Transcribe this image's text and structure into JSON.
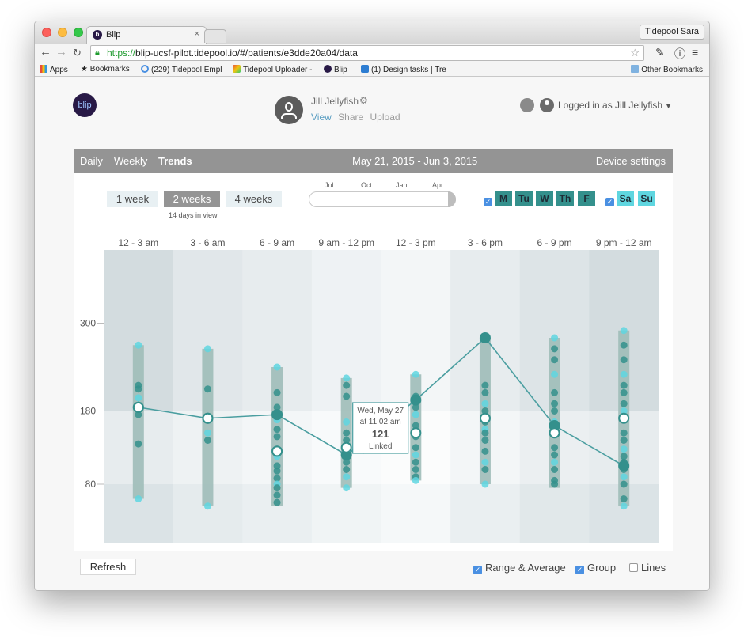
{
  "browser": {
    "tab_title": "Blip",
    "tab_close": "×",
    "profile": "Tidepool Sara",
    "url_protocol": "https://",
    "url_rest": "blip-ucsf-pilot.tidepool.io/#/patients/e3dde20a04/data",
    "bookmarks": [
      {
        "label": "Apps",
        "icon": "apps-grid-icon"
      },
      {
        "label": "Bookmarks",
        "icon": "star-icon"
      },
      {
        "label": "(229) Tidepool Empl",
        "icon": "tidepool-icon"
      },
      {
        "label": "Tidepool Uploader -",
        "icon": "uploader-icon"
      },
      {
        "label": "Blip",
        "icon": "blip-icon"
      },
      {
        "label": "(1) Design tasks | Tre",
        "icon": "trello-icon"
      }
    ],
    "other_bookmarks": "Other Bookmarks"
  },
  "header": {
    "logo_text": "blip",
    "patient_name": "Jill Jellyfish",
    "links": {
      "view": "View",
      "share": "Share",
      "upload": "Upload"
    },
    "logged_in": "Logged in as Jill Jellyfish"
  },
  "nav": {
    "daily": "Daily",
    "weekly": "Weekly",
    "trends": "Trends",
    "date_range": "May 21, 2015 - Jun 3, 2015",
    "device_settings": "Device settings"
  },
  "controls": {
    "ranges": [
      "1 week",
      "2 weeks",
      "4 weeks"
    ],
    "active_range": "2 weeks",
    "days_in_view": "14 days in view",
    "timeline_labels": [
      "Jul",
      "Oct",
      "Jan",
      "Apr"
    ],
    "weekdays": [
      "M",
      "Tu",
      "W",
      "Th",
      "F"
    ],
    "weekend": [
      "Sa",
      "Su"
    ],
    "weekday_color": "#34908c",
    "weekend_color": "#5fd6e0"
  },
  "chart_data": {
    "type": "scatter",
    "categories": [
      "12 - 3 am",
      "3 - 6 am",
      "6 - 9 am",
      "9 am - 12 pm",
      "12 - 3 pm",
      "3 - 6 pm",
      "6 - 9 pm",
      "9 pm - 12 am"
    ],
    "y_ticks": [
      80,
      180,
      300
    ],
    "ylim": [
      0,
      400
    ],
    "target_range": [
      80,
      180
    ],
    "range_min": [
      60,
      50,
      50,
      75,
      85,
      80,
      75,
      50
    ],
    "range_max": [
      270,
      265,
      240,
      225,
      230,
      280,
      280,
      290
    ],
    "means": [
      185,
      170,
      175,
      120,
      195,
      280,
      160,
      105
    ],
    "medians": [
      185,
      170,
      125,
      130,
      150,
      170,
      150,
      170
    ],
    "points": [
      [
        270,
        215,
        210,
        198,
        188,
        175,
        135,
        60
      ],
      [
        265,
        210,
        170,
        150,
        140,
        50
      ],
      [
        240,
        205,
        185,
        168,
        155,
        145,
        128,
        118,
        105,
        98,
        88,
        80,
        75,
        65,
        55
      ],
      [
        225,
        215,
        200,
        165,
        150,
        140,
        130,
        125,
        118,
        110,
        100,
        90,
        75
      ],
      [
        230,
        200,
        185,
        175,
        160,
        145,
        130,
        120,
        110,
        100,
        90,
        85
      ],
      [
        280,
        215,
        205,
        190,
        180,
        170,
        165,
        155,
        150,
        140,
        125,
        110,
        100,
        80
      ],
      [
        280,
        265,
        250,
        230,
        205,
        190,
        180,
        165,
        150,
        130,
        120,
        110,
        100,
        85,
        80
      ],
      [
        290,
        270,
        250,
        230,
        215,
        205,
        190,
        180,
        170,
        150,
        140,
        128,
        118,
        110,
        100,
        90,
        80,
        60,
        50
      ]
    ],
    "tooltip": {
      "date": "Wed, May 27",
      "time": "at 11:02 am",
      "value": "121",
      "source": "Linked"
    },
    "colors": {
      "point": "#34908c",
      "weekend_point": "#5fd6e0",
      "line": "#4a9ea0",
      "range_bar": "#9fbdb8"
    }
  },
  "footer": {
    "refresh": "Refresh",
    "range_average": "Range & Average",
    "group": "Group",
    "lines": "Lines"
  }
}
